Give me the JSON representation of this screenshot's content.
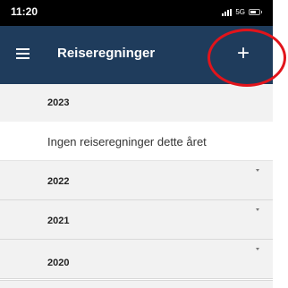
{
  "status_bar": {
    "time": "11:20",
    "network": "5G"
  },
  "app_bar": {
    "title": "Reiseregninger",
    "add_label": "+"
  },
  "years": [
    {
      "label": "2023",
      "expandable": false
    },
    {
      "label": "2022",
      "expandable": true
    },
    {
      "label": "2021",
      "expandable": true
    },
    {
      "label": "2020",
      "expandable": true
    }
  ],
  "empty_message": "Ingen reiseregninger dette året",
  "colors": {
    "app_bar": "#1f3c5c",
    "highlight": "#e2141b",
    "row_background": "#f2f2f2"
  }
}
